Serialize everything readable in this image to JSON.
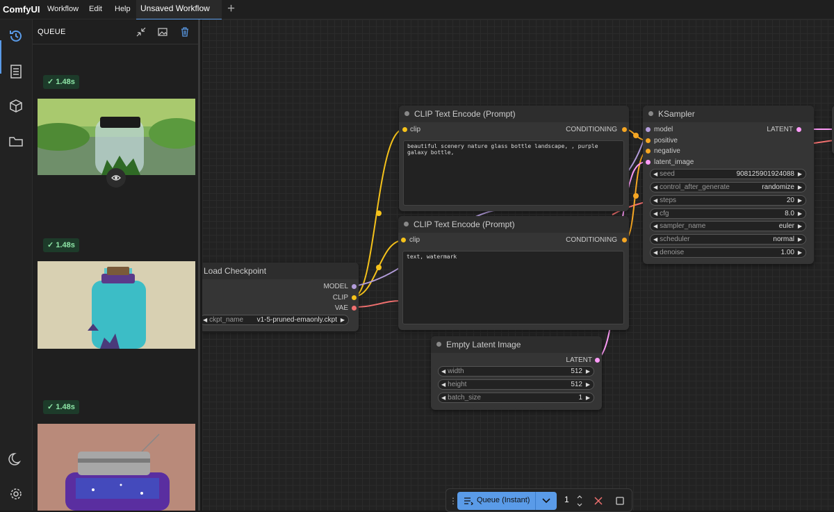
{
  "app": {
    "name": "ComfyUI"
  },
  "menu": [
    "Workflow",
    "Edit",
    "Help"
  ],
  "tabs": {
    "active": "Unsaved Workflow",
    "add_icon": "plus-icon"
  },
  "sidebar_icons": [
    "history-icon",
    "document-icon",
    "cube-icon",
    "folder-icon",
    "moon-icon",
    "gear-icon"
  ],
  "queue": {
    "title": "QUEUE",
    "header_icons": [
      "collapse-icon",
      "image-icon",
      "trash-icon"
    ],
    "items": [
      {
        "time": "1.48s",
        "image": "glass bottle with tiny forest"
      },
      {
        "time": "1.48s",
        "image": "teal glass bottle"
      },
      {
        "time": "1.48s",
        "image": "galaxy jar"
      }
    ]
  },
  "nodes": {
    "clip1": {
      "title": "CLIP Text Encode (Prompt)",
      "input": "clip",
      "output": "CONDITIONING",
      "text": "beautiful scenery nature glass bottle landscape, , purple galaxy bottle,"
    },
    "clip2": {
      "title": "CLIP Text Encode (Prompt)",
      "input": "clip",
      "output": "CONDITIONING",
      "text": "text, watermark"
    },
    "ksampler": {
      "title": "KSampler",
      "inputs": [
        "model",
        "positive",
        "negative",
        "latent_image"
      ],
      "output": "LATENT",
      "widgets": [
        {
          "label": "seed",
          "value": "908125901924088"
        },
        {
          "label": "control_after_generate",
          "value": "randomize"
        },
        {
          "label": "steps",
          "value": "20"
        },
        {
          "label": "cfg",
          "value": "8.0"
        },
        {
          "label": "sampler_name",
          "value": "euler"
        },
        {
          "label": "scheduler",
          "value": "normal"
        },
        {
          "label": "denoise",
          "value": "1.00"
        }
      ]
    },
    "checkpoint": {
      "title": "Load Checkpoint",
      "outputs": [
        "MODEL",
        "CLIP",
        "VAE"
      ],
      "widget": {
        "label": "ckpt_name",
        "value": "v1-5-pruned-emaonly.ckpt"
      }
    },
    "latent": {
      "title": "Empty Latent Image",
      "output": "LATENT",
      "widgets": [
        {
          "label": "width",
          "value": "512"
        },
        {
          "label": "height",
          "value": "512"
        },
        {
          "label": "batch_size",
          "value": "1"
        }
      ]
    }
  },
  "queue_bar": {
    "button_label": "Queue (Instant)",
    "count": "1"
  },
  "colors": {
    "accent": "#5a9be8",
    "clip_wire": "#f5c21b",
    "model_wire": "#b39ddb",
    "vae_wire": "#f0706f",
    "cond_wire": "#f5a623",
    "latent_wire": "#ff9cf9"
  }
}
